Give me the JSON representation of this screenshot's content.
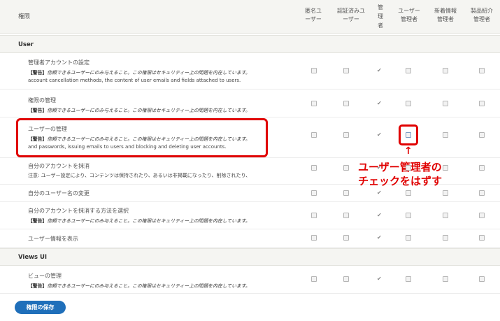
{
  "header": {
    "permission": "権限",
    "columns": [
      {
        "line1": "匿名ユ",
        "line2": "ーザー"
      },
      {
        "line1": "認証済みユ",
        "line2": "ーザー"
      },
      {
        "line1": "管",
        "line2": "理",
        "line3": "者"
      },
      {
        "line1": "ユーザー",
        "line2": "管理者"
      },
      {
        "line1": "新着情報",
        "line2": "管理者"
      },
      {
        "line1": "製品紹介",
        "line2": "管理者"
      }
    ]
  },
  "sections": [
    {
      "title": "User"
    },
    {
      "title": "Views UI"
    }
  ],
  "warning_prefix": "【警告】",
  "warning_text": "信頼できるユーザーにのみ与えること。この権限はセキュリティー上の問題を内在しています。",
  "rows": [
    {
      "title": "管理者アカウントの設定",
      "desc": "account cancellation methods, the content of user emails and fields attached to users.",
      "checked": [
        false,
        false,
        true,
        false,
        false,
        false
      ]
    },
    {
      "title": "権限の管理",
      "desc": "",
      "checked": [
        false,
        false,
        true,
        false,
        false,
        false
      ]
    },
    {
      "title": "ユーザーの管理",
      "desc": "and passwords, issuing emails to users and blocking and deleting user accounts.",
      "checked": [
        false,
        false,
        true,
        false,
        false,
        false
      ]
    },
    {
      "title": "自分のアカウントを抹消",
      "note": "注意: ユーザー設定により、コンテンツは保持されたり、あるいは非掲載になったり、削除されたり、",
      "checked": [
        false,
        false,
        true,
        false,
        false,
        false
      ]
    },
    {
      "title": "自分のユーザー名の変更",
      "checked": [
        false,
        false,
        true,
        false,
        false,
        false
      ]
    },
    {
      "title": "自分のアカウントを抹消する方法を選択",
      "desc": "",
      "checked": [
        false,
        false,
        true,
        false,
        false,
        false
      ]
    },
    {
      "title": "ユーザー情報を表示",
      "checked": [
        false,
        false,
        true,
        false,
        false,
        false
      ]
    },
    {
      "title": "ビューの管理",
      "desc": "",
      "checked": [
        false,
        false,
        true,
        false,
        false,
        false
      ]
    }
  ],
  "annotation": {
    "line1": "ユーザー管理者の",
    "line2": "チェックをはずす",
    "arrow": "↑"
  },
  "save_button": "権限の保存",
  "colors": {
    "accent": "#1f6fba",
    "annotation": "#e00000"
  }
}
